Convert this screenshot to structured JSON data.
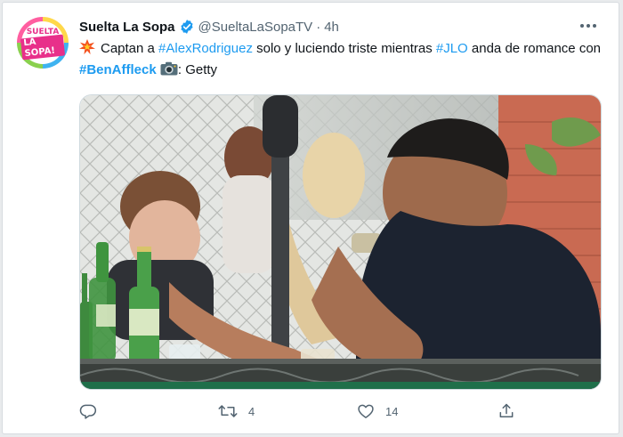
{
  "tweet": {
    "author": {
      "name": "Suelta La Sopa",
      "handle": "@SueltaLaSopaTV",
      "avatar_text_top": "SUELTA",
      "avatar_text_bottom": "LA SOPA!"
    },
    "separator": "·",
    "time": "4h",
    "text": {
      "p1": "Captan a ",
      "tag1": "#AlexRodriguez",
      "p2": " solo y luciendo triste mientras ",
      "tag2": "#JLO",
      "p3": " anda de romance con ",
      "tag3": "#BenAffleck",
      "p4": ": Getty"
    },
    "actions": {
      "reply_count": "",
      "retweet_count": "4",
      "like_count": "14"
    },
    "colors": {
      "link": "#1d9bf0",
      "secondary": "#536471",
      "verified": "#1d9bf0"
    },
    "icons": [
      "burst-emoji-icon",
      "camera-emoji-icon",
      "verified-badge-icon",
      "more-icon",
      "reply-icon",
      "retweet-icon",
      "like-icon",
      "share-icon"
    ]
  }
}
